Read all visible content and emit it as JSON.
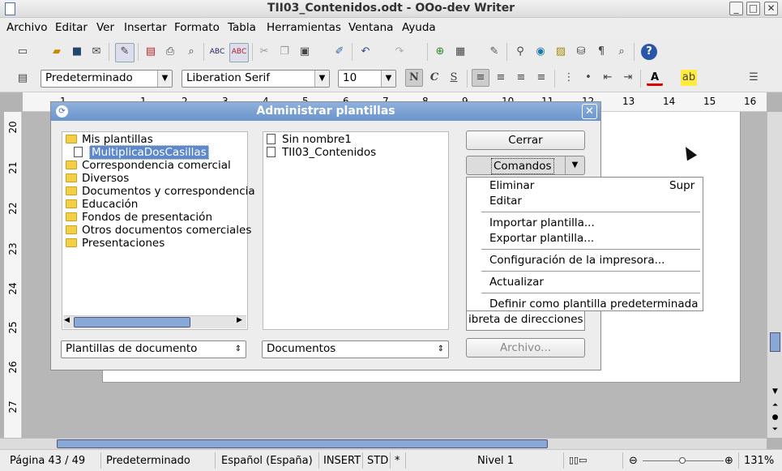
{
  "window": {
    "title": "TII03_Contenidos.odt - OOo-dev Writer",
    "controls": [
      "_",
      "□",
      "✕"
    ]
  },
  "menu": [
    "Archivo",
    "Editar",
    "Ver",
    "Insertar",
    "Formato",
    "Tabla",
    "Herramientas",
    "Ventana",
    "Ayuda"
  ],
  "format_bar": {
    "style": "Predeterminado",
    "font": "Liberation Serif",
    "size": "10",
    "bold": "N",
    "italic": "C",
    "underline": "S"
  },
  "ruler": {
    "h_numbers": [
      "1",
      "1",
      "2",
      "3",
      "4",
      "5",
      "6",
      "7",
      "8",
      "9",
      "10",
      "11",
      "12",
      "13",
      "14",
      "15",
      "16"
    ],
    "v_numbers": [
      "20",
      "21",
      "22",
      "23",
      "24",
      "25",
      "26",
      "27"
    ]
  },
  "dialog": {
    "title": "Administrar plantillas",
    "left_tree": {
      "root": "Mis plantillas",
      "selected_child": "MultiplicaDosCasillas",
      "folders": [
        "Correspondencia comercial",
        "Diversos",
        "Documentos y correspondencia",
        "Educación",
        "Fondos de presentación",
        "Otros documentos comerciales",
        "Presentaciones"
      ]
    },
    "right_list": [
      "Sin nombre1",
      "TII03_Contenidos"
    ],
    "left_select": "Plantillas de documento",
    "right_select": "Documentos",
    "buttons": {
      "close": "Cerrar",
      "commands": "Comandos",
      "file": "Archivo..."
    },
    "hidden_text": "ibreta de direcciones."
  },
  "commands_menu": {
    "delete": "Eliminar",
    "delete_shortcut": "Supr",
    "edit": "Editar",
    "import": "Importar plantilla...",
    "export": "Exportar plantilla...",
    "printer": "Configuración de la impresora...",
    "refresh": "Actualizar",
    "set_default": "Definir como plantilla predeterminada"
  },
  "status": {
    "page": "Página  43 / 49",
    "style": "Predeterminado",
    "language": "Español (España)",
    "insert": "INSERT",
    "std": "STD",
    "modified": "*",
    "level": "Nivel  1",
    "zoom": "131%"
  }
}
